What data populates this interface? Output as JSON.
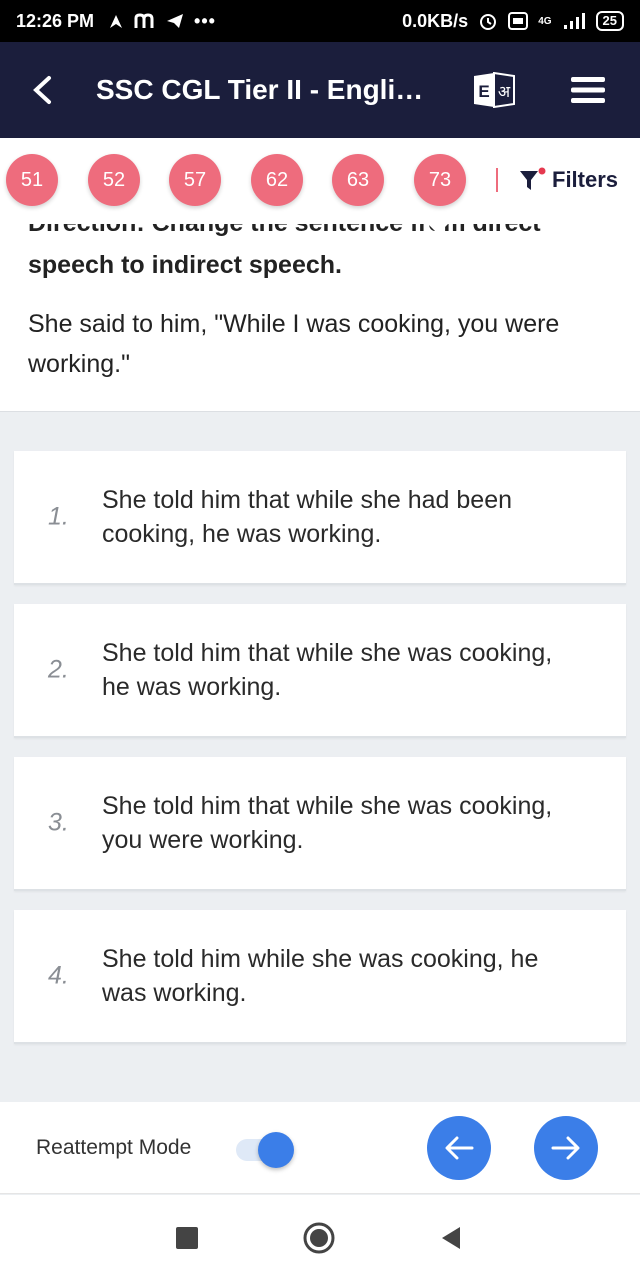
{
  "status_bar": {
    "time": "12:26 PM",
    "net_speed": "0.0KB/s",
    "battery": "25",
    "network": "4G"
  },
  "header": {
    "title": "SSC CGL Tier II - English...",
    "lang_toggle": "E अ"
  },
  "question_nav": {
    "chips": [
      "51",
      "52",
      "57",
      "62",
      "63",
      "73"
    ],
    "filters_label": "Filters"
  },
  "question": {
    "direction": "Direction: Change the sentence from direct speech to indirect speech.",
    "text": "She said to him, \"While I was cooking, you were working.\""
  },
  "options": [
    {
      "num": "1.",
      "text": "She told him that while she had been cooking, he was working."
    },
    {
      "num": "2.",
      "text": "She told him that while she was cooking, he was working."
    },
    {
      "num": "3.",
      "text": "She told him that while she was cooking, you were working."
    },
    {
      "num": "4.",
      "text": "She told him while she was cooking, he was working."
    }
  ],
  "bottom_bar": {
    "reattempt_label": "Reattempt Mode",
    "reattempt_on": true
  },
  "colors": {
    "header_bg": "#1b1e3c",
    "chip": "#ee6c7d",
    "accent": "#3b7ee8"
  }
}
